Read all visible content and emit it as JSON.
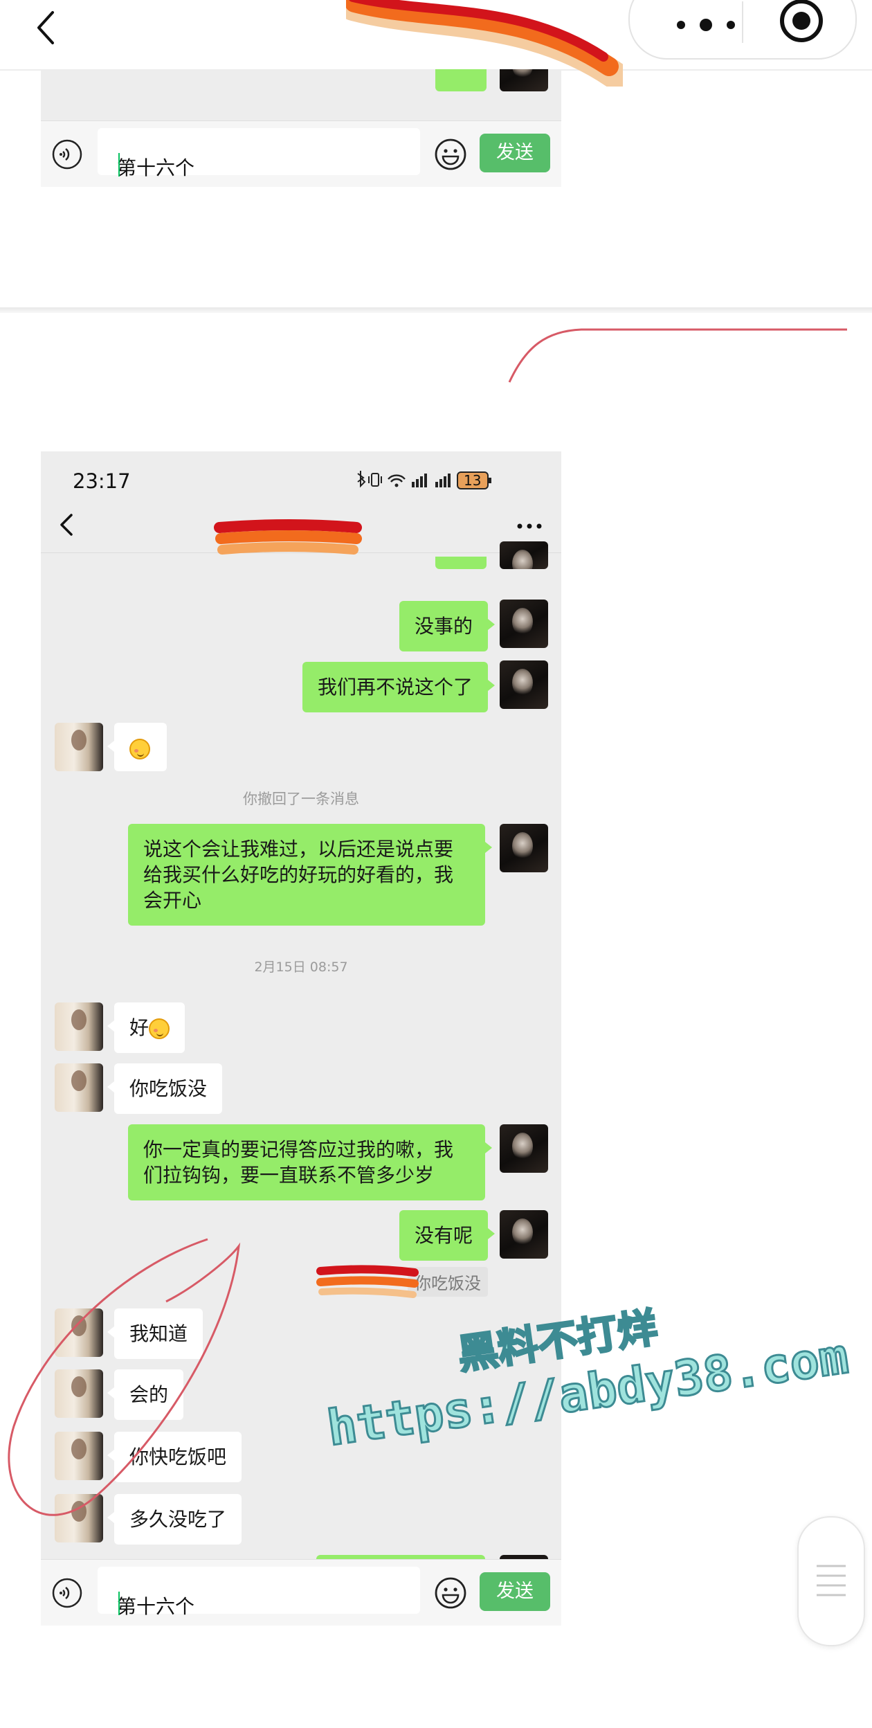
{
  "top_input_bar": {
    "draft_text": "第十六个",
    "send_label": "发送"
  },
  "chat": {
    "status_time": "23:17",
    "battery": "13",
    "messages": {
      "m1": "没事的",
      "m2": "我们再不说这个了",
      "sys1": "你撤回了一条消息",
      "m3": "说这个会让我难过，以后还是说点要给我买什么好吃的好玩的好看的，我会开心",
      "sys2": "2月15日 08:57",
      "m4": "好",
      "m5": "你吃饭没",
      "m6": "你一定真的要记得答应过我的嗽，我们拉钩钩，要一直联系不管多少岁",
      "m7": "没有呢",
      "quote1": "你吃饭没",
      "m8": "我知道",
      "m9": "会的",
      "m10": "你快吃饭吧",
      "m11": "多久没吃了"
    }
  },
  "bottom_input_bar": {
    "draft_text": "第十六个",
    "send_label": "发送"
  },
  "watermark": {
    "line1": "黑料不打烊",
    "line2": "https://abdy38.com"
  },
  "icons": {
    "outer_back": "chevron-left-icon",
    "capsule_more": "more-dots-icon",
    "capsule_close": "target-circle-icon",
    "voice": "voice-icon",
    "emoji": "smiley-icon",
    "floating": "menu-lines-icon"
  },
  "colors": {
    "my_bubble": "#95ec69",
    "other_bubble": "#ffffff",
    "chat_bg": "#ededed",
    "send_button": "#57be6a"
  }
}
